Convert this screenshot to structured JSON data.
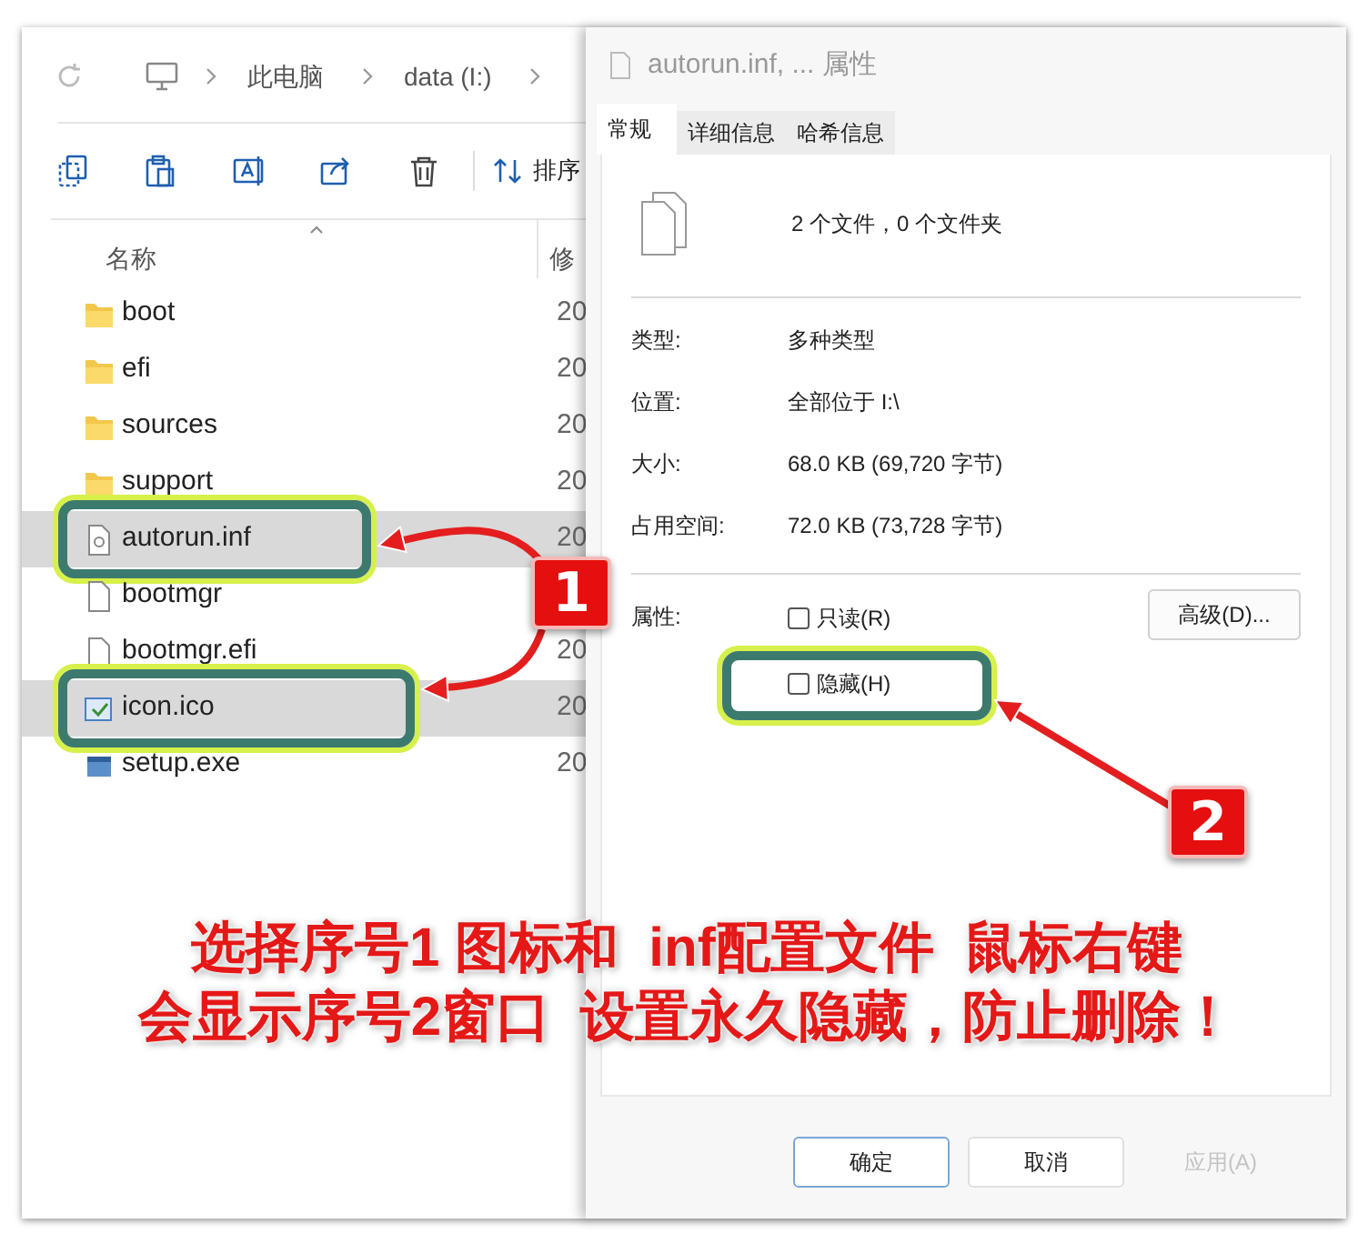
{
  "explorer": {
    "breadcrumb": [
      "此电脑",
      "data (I:)"
    ],
    "sort_label": "排序",
    "columns": [
      "名称",
      "修"
    ],
    "files": [
      {
        "name": "boot",
        "kind": "folder",
        "date": "20",
        "selected": false,
        "marked": false
      },
      {
        "name": "efi",
        "kind": "folder",
        "date": "20",
        "selected": false,
        "marked": false
      },
      {
        "name": "sources",
        "kind": "folder",
        "date": "20",
        "selected": false,
        "marked": false
      },
      {
        "name": "support",
        "kind": "folder",
        "date": "20",
        "selected": false,
        "marked": false
      },
      {
        "name": "autorun.inf",
        "kind": "settings",
        "date": "20",
        "selected": true,
        "marked": true
      },
      {
        "name": "bootmgr",
        "kind": "file",
        "selected": false,
        "marked": false
      },
      {
        "name": "bootmgr.efi",
        "kind": "file",
        "date": "20",
        "selected": false,
        "marked": false
      },
      {
        "name": "icon.ico",
        "kind": "image",
        "date": "20",
        "selected": true,
        "marked": true
      },
      {
        "name": "setup.exe",
        "kind": "app",
        "date": "20",
        "selected": false,
        "marked": false
      }
    ]
  },
  "dialog": {
    "title": "autorun.inf, ... 属性",
    "tabs": [
      {
        "label": "常规",
        "selected": true
      },
      {
        "label": "详细信息",
        "selected": false
      },
      {
        "label": "哈希信息",
        "selected": false
      }
    ],
    "summary": "2 个文件，0 个文件夹",
    "properties": [
      {
        "label": "类型:",
        "value": "多种类型"
      },
      {
        "label": "位置:",
        "value": "全部位于 I:\\"
      },
      {
        "label": "大小:",
        "value": "68.0 KB (69,720 字节)"
      },
      {
        "label": "占用空间:",
        "value": "72.0 KB (73,728 字节)"
      }
    ],
    "attributes_label": "属性:",
    "attributes": [
      {
        "label": "只读(R)",
        "checked": false,
        "marked": false
      },
      {
        "label": "隐藏(H)",
        "checked": false,
        "marked": true
      }
    ],
    "advanced_button": "高级(D)...",
    "buttons": [
      {
        "label": "确定",
        "disabled": false
      },
      {
        "label": "取消",
        "disabled": false
      },
      {
        "label": "应用(A)",
        "disabled": true
      }
    ]
  },
  "annotations": {
    "badges": [
      "1",
      "2"
    ],
    "caption": [
      "选择序号1 图标和  inf配置文件  鼠标右键",
      "会显示序号2窗口  设置永久隐藏，防止删除！"
    ]
  }
}
